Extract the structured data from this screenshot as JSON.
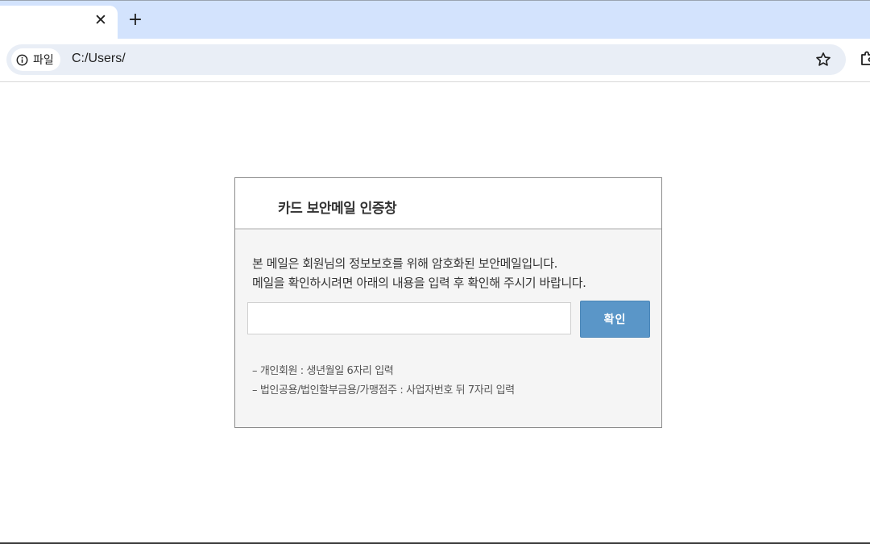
{
  "browser": {
    "tab": {
      "close_glyph": "✕"
    },
    "new_tab_glyph": "+",
    "site_chip": {
      "icon": "info-icon",
      "label": "파일"
    },
    "url": "C:/Users/",
    "bookmark_icon": "star-icon",
    "extensions_icon": "puzzle-icon"
  },
  "dialog": {
    "title": "카드 보안메일 인증창",
    "description": [
      "본 메일은 회원님의 정보보호를 위해 암호화된 보안메일입니다.",
      "메일을 확인하시려면 아래의 내용을 입력 후 확인해 주시기 바랍니다."
    ],
    "input_value": "",
    "confirm_label": "확인",
    "notes": [
      "– 개인회원 : 생년월일 6자리 입력",
      "– 법인공용/법인할부금용/가맹점주 : 사업자번호 뒤 7자리 입력"
    ]
  },
  "colors": {
    "tabstrip_bg": "#d3e3fd",
    "omnibox_bg": "#e9eef6",
    "confirm_button": "#5a96c8"
  }
}
